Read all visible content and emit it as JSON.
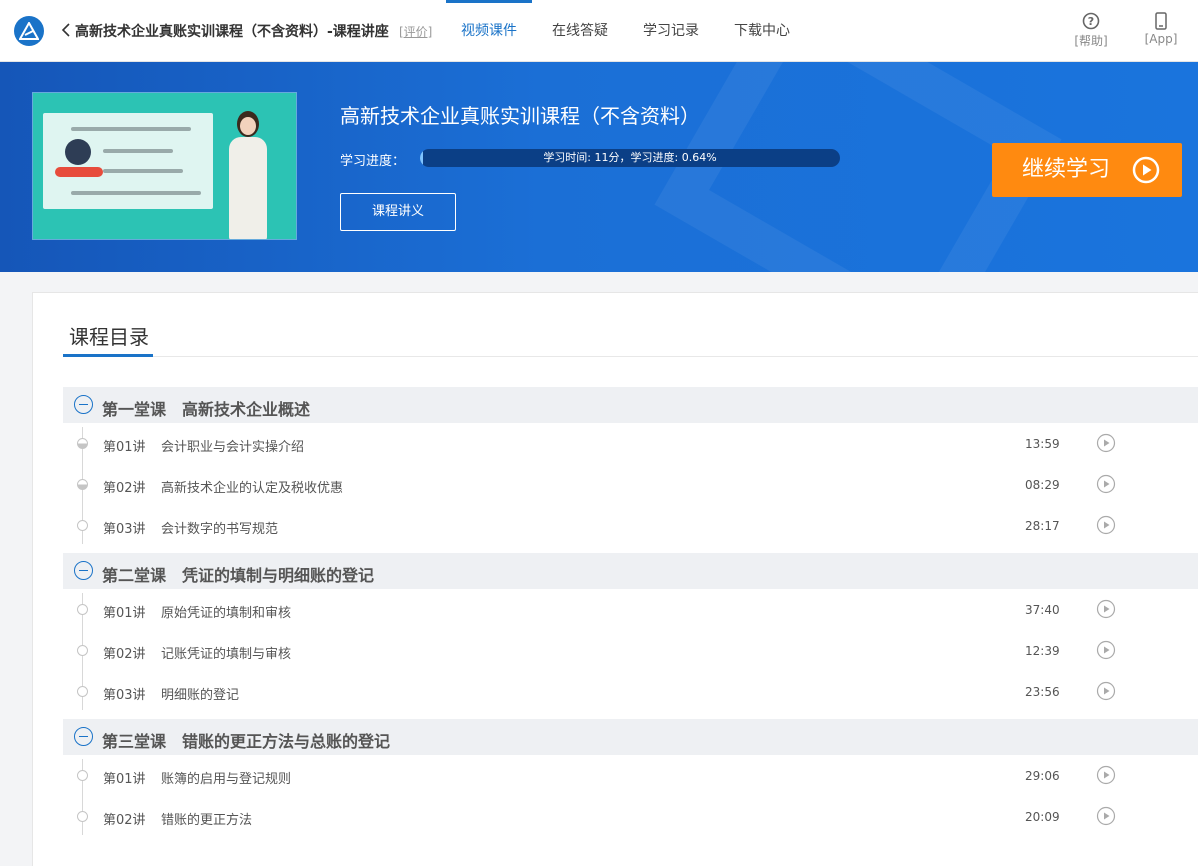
{
  "header": {
    "course_title": "高新技术企业真账实训课程（不含资料）-课程讲座",
    "rate_link": "[评价]",
    "nav": [
      {
        "label": "视频课件",
        "active": true
      },
      {
        "label": "在线答疑",
        "active": false
      },
      {
        "label": "学习记录",
        "active": false
      },
      {
        "label": "下载中心",
        "active": false
      }
    ],
    "help_label": "[帮助]",
    "app_label": "[App]",
    "icons": [
      "logo-icon",
      "back-arrow-icon",
      "help-circle-icon",
      "phone-icon"
    ]
  },
  "banner": {
    "title": "高新技术企业真账实训课程（不含资料）",
    "progress_label": "学习进度：",
    "progress_text": "学习时间: 11分，学习进度: 0.64%",
    "progress_fraction": 0.0064,
    "lecture_button": "课程讲义",
    "continue_button": "继续学习",
    "colors": {
      "banner": "#1b6fd6",
      "accent": "#ff8a10"
    }
  },
  "catalog": {
    "title": "课程目录",
    "chapters": [
      {
        "name": "第一堂课　高新技术企业概述",
        "lessons": [
          {
            "no": "第01讲",
            "name": "会计职业与会计实操介绍",
            "duration": "13:59",
            "status": "partial"
          },
          {
            "no": "第02讲",
            "name": "高新技术企业的认定及税收优惠",
            "duration": "08:29",
            "status": "partial"
          },
          {
            "no": "第03讲",
            "name": "会计数字的书写规范",
            "duration": "28:17",
            "status": "none"
          }
        ]
      },
      {
        "name": "第二堂课　凭证的填制与明细账的登记",
        "lessons": [
          {
            "no": "第01讲",
            "name": "原始凭证的填制和审核",
            "duration": "37:40",
            "status": "none"
          },
          {
            "no": "第02讲",
            "name": "记账凭证的填制与审核",
            "duration": "12:39",
            "status": "none"
          },
          {
            "no": "第03讲",
            "name": "明细账的登记",
            "duration": "23:56",
            "status": "none"
          }
        ]
      },
      {
        "name": "第三堂课　错账的更正方法与总账的登记",
        "lessons": [
          {
            "no": "第01讲",
            "name": "账簿的启用与登记规则",
            "duration": "29:06",
            "status": "none"
          },
          {
            "no": "第02讲",
            "name": "错账的更正方法",
            "duration": "20:09",
            "status": "none"
          }
        ]
      }
    ]
  }
}
